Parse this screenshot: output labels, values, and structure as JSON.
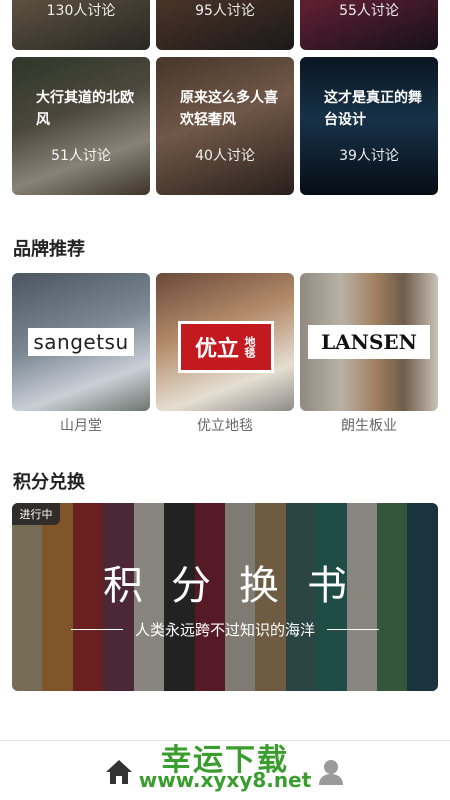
{
  "topics_row1": [
    {
      "count": "130人讨论"
    },
    {
      "count": "95人讨论"
    },
    {
      "count": "55人讨论"
    }
  ],
  "topics_row2": [
    {
      "title": "大行其道的北欧风",
      "count": "51人讨论"
    },
    {
      "title": "原来这么多人喜欢轻奢风",
      "count": "40人讨论"
    },
    {
      "title": "这才是真正的舞台设计",
      "count": "39人讨论"
    }
  ],
  "brand_section": {
    "title": "品牌推荐",
    "brands": [
      {
        "logo": "sangetsu",
        "name": "山月堂"
      },
      {
        "logo": "优立",
        "logo_sub": "地毯",
        "name": "优立地毯"
      },
      {
        "logo": "LANSEN",
        "name": "朗生板业"
      }
    ]
  },
  "points_section": {
    "title": "积分兑换",
    "badge": "进行中",
    "banner_title": "积分换书",
    "banner_subtitle": "人类永远跨不过知识的海洋"
  },
  "watermark": {
    "line1": "幸运下载",
    "line2": "www.xyxy8.net"
  },
  "tabbar": {
    "icons": [
      "home-icon",
      "user-icon"
    ]
  },
  "colors": {
    "watermark_green": "#3a9e2e",
    "youli_red": "#c21a1f"
  }
}
